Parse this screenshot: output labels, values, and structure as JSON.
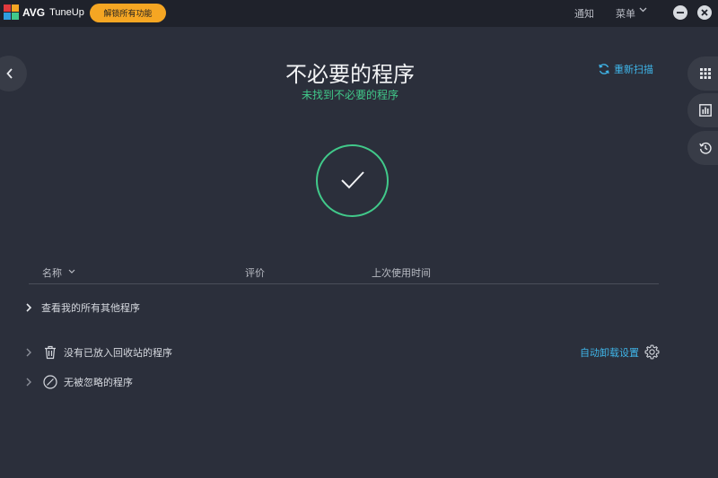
{
  "titlebar": {
    "brand": "AVG",
    "app_name": "TuneUp",
    "unlock_label": "解锁所有功能",
    "notify_label": "通知",
    "menu_label": "菜单"
  },
  "main": {
    "title": "不必要的程序",
    "subtitle": "未找到不必要的程序",
    "rescan_label": "重新扫描"
  },
  "table": {
    "columns": [
      "名称",
      "评价",
      "上次使用时间"
    ]
  },
  "rows": {
    "others": "查看我的所有其他程序",
    "unused": "没有已放入回收站的程序",
    "ignored": "无被忽略的程序"
  },
  "auto_uninstall_label": "自动卸载设置",
  "colors": {
    "accent_orange": "#f5a623",
    "success_green": "#41c98a",
    "link_blue": "#3fb6ea",
    "background": "#2b2f3b"
  },
  "icons": [
    "avg-logo-icon",
    "minimize-icon",
    "close-icon",
    "back-arrow-icon",
    "apps-grid-icon",
    "stats-icon",
    "history-icon",
    "refresh-icon",
    "checkmark-icon",
    "trash-icon",
    "ban-icon",
    "gear-icon"
  ]
}
